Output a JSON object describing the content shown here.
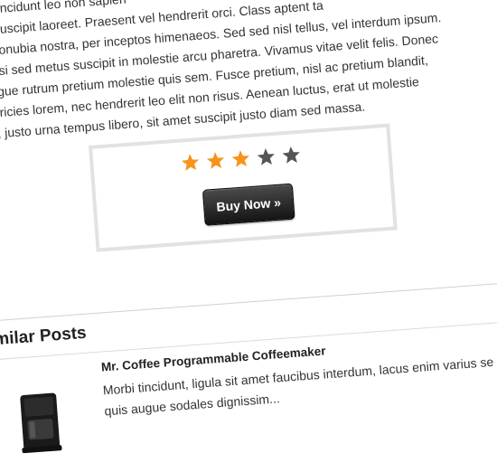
{
  "article": {
    "lines": [
      "andisse tincidunt leo non sapien",
      "isis orci suscipit laoreet. Praesent vel hendrerit orci. Class aptent ta",
      "ent per conubia nostra, per inceptos himenaeos. Sed sed nisl tellus, vel interdum ipsum.",
      "eugiat nisi sed metus suscipit in molestie arcu pharetra. Vivamus vitae velit felis. Donec",
      "rci at augue rutrum pretium molestie quis sem. Fusce pretium, nisl ac pretium blandit,",
      "s nisl ultricies lorem, nec hendrerit leo elit non risus. Aenean luctus, erat ut molestie",
      "ncorper, justo urna tempus libero, sit amet suscipit justo diam sed massa."
    ]
  },
  "rating": {
    "value": 3,
    "max": 5,
    "filled_color": "#f7941d",
    "empty_color": "#555555"
  },
  "buy_button": {
    "label": "Buy Now »"
  },
  "similar_posts": {
    "title": "Similar Posts",
    "items": [
      {
        "title": "Mr. Coffee Programmable Coffeemaker",
        "excerpt_lines": [
          "Morbi tincidunt, ligula sit amet faucibus interdum, lacus enim varius se",
          "quis augue sodales dignissim..."
        ]
      }
    ]
  }
}
